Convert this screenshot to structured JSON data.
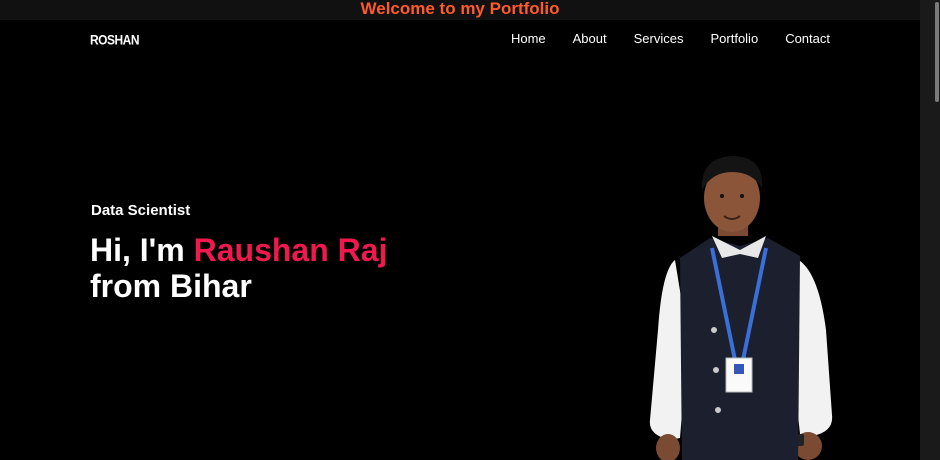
{
  "banner": {
    "text": "Welcome to my Portfolio"
  },
  "navbar": {
    "logo": "ROSHAN",
    "menu": [
      "Home",
      "About",
      "Services",
      "Portfolio",
      "Contact"
    ]
  },
  "hero": {
    "subtitle": "Data Scientist",
    "greeting": "Hi, I'm ",
    "name": "Raushan Raj",
    "location": "from Bihar"
  },
  "colors": {
    "banner_text": "#ff5a2e",
    "name_accent": "#f0194e",
    "background": "#000000"
  }
}
